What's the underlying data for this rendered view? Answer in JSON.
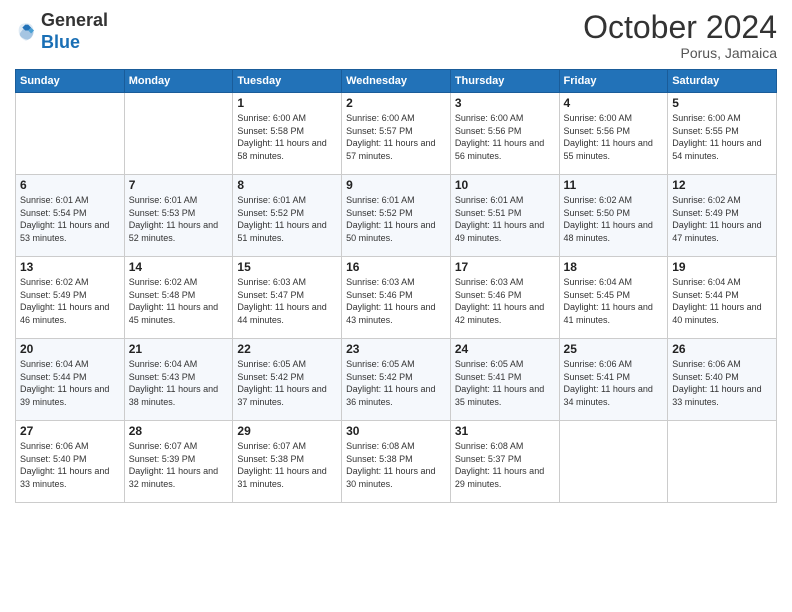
{
  "header": {
    "logo_general": "General",
    "logo_blue": "Blue",
    "month_title": "October 2024",
    "location": "Porus, Jamaica"
  },
  "weekdays": [
    "Sunday",
    "Monday",
    "Tuesday",
    "Wednesday",
    "Thursday",
    "Friday",
    "Saturday"
  ],
  "weeks": [
    [
      {
        "day": "",
        "info": ""
      },
      {
        "day": "",
        "info": ""
      },
      {
        "day": "1",
        "info": "Sunrise: 6:00 AM\nSunset: 5:58 PM\nDaylight: 11 hours and 58 minutes."
      },
      {
        "day": "2",
        "info": "Sunrise: 6:00 AM\nSunset: 5:57 PM\nDaylight: 11 hours and 57 minutes."
      },
      {
        "day": "3",
        "info": "Sunrise: 6:00 AM\nSunset: 5:56 PM\nDaylight: 11 hours and 56 minutes."
      },
      {
        "day": "4",
        "info": "Sunrise: 6:00 AM\nSunset: 5:56 PM\nDaylight: 11 hours and 55 minutes."
      },
      {
        "day": "5",
        "info": "Sunrise: 6:00 AM\nSunset: 5:55 PM\nDaylight: 11 hours and 54 minutes."
      }
    ],
    [
      {
        "day": "6",
        "info": "Sunrise: 6:01 AM\nSunset: 5:54 PM\nDaylight: 11 hours and 53 minutes."
      },
      {
        "day": "7",
        "info": "Sunrise: 6:01 AM\nSunset: 5:53 PM\nDaylight: 11 hours and 52 minutes."
      },
      {
        "day": "8",
        "info": "Sunrise: 6:01 AM\nSunset: 5:52 PM\nDaylight: 11 hours and 51 minutes."
      },
      {
        "day": "9",
        "info": "Sunrise: 6:01 AM\nSunset: 5:52 PM\nDaylight: 11 hours and 50 minutes."
      },
      {
        "day": "10",
        "info": "Sunrise: 6:01 AM\nSunset: 5:51 PM\nDaylight: 11 hours and 49 minutes."
      },
      {
        "day": "11",
        "info": "Sunrise: 6:02 AM\nSunset: 5:50 PM\nDaylight: 11 hours and 48 minutes."
      },
      {
        "day": "12",
        "info": "Sunrise: 6:02 AM\nSunset: 5:49 PM\nDaylight: 11 hours and 47 minutes."
      }
    ],
    [
      {
        "day": "13",
        "info": "Sunrise: 6:02 AM\nSunset: 5:49 PM\nDaylight: 11 hours and 46 minutes."
      },
      {
        "day": "14",
        "info": "Sunrise: 6:02 AM\nSunset: 5:48 PM\nDaylight: 11 hours and 45 minutes."
      },
      {
        "day": "15",
        "info": "Sunrise: 6:03 AM\nSunset: 5:47 PM\nDaylight: 11 hours and 44 minutes."
      },
      {
        "day": "16",
        "info": "Sunrise: 6:03 AM\nSunset: 5:46 PM\nDaylight: 11 hours and 43 minutes."
      },
      {
        "day": "17",
        "info": "Sunrise: 6:03 AM\nSunset: 5:46 PM\nDaylight: 11 hours and 42 minutes."
      },
      {
        "day": "18",
        "info": "Sunrise: 6:04 AM\nSunset: 5:45 PM\nDaylight: 11 hours and 41 minutes."
      },
      {
        "day": "19",
        "info": "Sunrise: 6:04 AM\nSunset: 5:44 PM\nDaylight: 11 hours and 40 minutes."
      }
    ],
    [
      {
        "day": "20",
        "info": "Sunrise: 6:04 AM\nSunset: 5:44 PM\nDaylight: 11 hours and 39 minutes."
      },
      {
        "day": "21",
        "info": "Sunrise: 6:04 AM\nSunset: 5:43 PM\nDaylight: 11 hours and 38 minutes."
      },
      {
        "day": "22",
        "info": "Sunrise: 6:05 AM\nSunset: 5:42 PM\nDaylight: 11 hours and 37 minutes."
      },
      {
        "day": "23",
        "info": "Sunrise: 6:05 AM\nSunset: 5:42 PM\nDaylight: 11 hours and 36 minutes."
      },
      {
        "day": "24",
        "info": "Sunrise: 6:05 AM\nSunset: 5:41 PM\nDaylight: 11 hours and 35 minutes."
      },
      {
        "day": "25",
        "info": "Sunrise: 6:06 AM\nSunset: 5:41 PM\nDaylight: 11 hours and 34 minutes."
      },
      {
        "day": "26",
        "info": "Sunrise: 6:06 AM\nSunset: 5:40 PM\nDaylight: 11 hours and 33 minutes."
      }
    ],
    [
      {
        "day": "27",
        "info": "Sunrise: 6:06 AM\nSunset: 5:40 PM\nDaylight: 11 hours and 33 minutes."
      },
      {
        "day": "28",
        "info": "Sunrise: 6:07 AM\nSunset: 5:39 PM\nDaylight: 11 hours and 32 minutes."
      },
      {
        "day": "29",
        "info": "Sunrise: 6:07 AM\nSunset: 5:38 PM\nDaylight: 11 hours and 31 minutes."
      },
      {
        "day": "30",
        "info": "Sunrise: 6:08 AM\nSunset: 5:38 PM\nDaylight: 11 hours and 30 minutes."
      },
      {
        "day": "31",
        "info": "Sunrise: 6:08 AM\nSunset: 5:37 PM\nDaylight: 11 hours and 29 minutes."
      },
      {
        "day": "",
        "info": ""
      },
      {
        "day": "",
        "info": ""
      }
    ]
  ]
}
